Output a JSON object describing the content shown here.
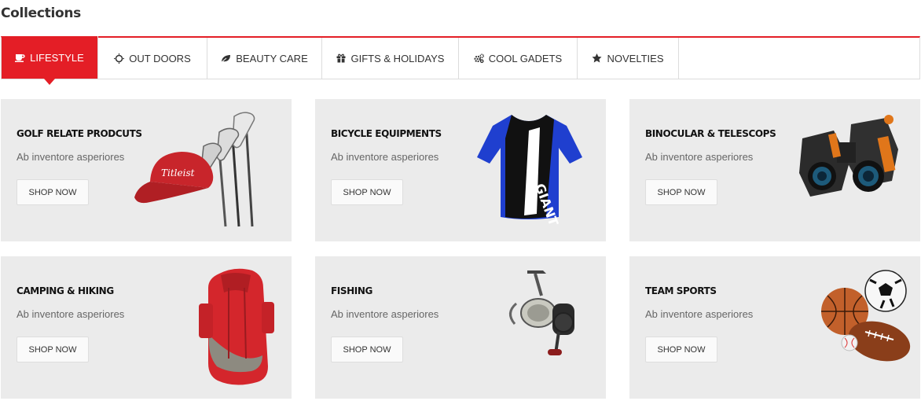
{
  "section": {
    "title": "Collections"
  },
  "tabs": [
    {
      "label": "LIFESTYLE",
      "icon": "cup-icon",
      "active": true
    },
    {
      "label": "OUT DOORS",
      "icon": "sun-icon",
      "active": false
    },
    {
      "label": "BEAUTY CARE",
      "icon": "leaf-icon",
      "active": false
    },
    {
      "label": "GIFTS & HOLIDAYS",
      "icon": "gift-icon",
      "active": false
    },
    {
      "label": "COOL GADETS",
      "icon": "gears-icon",
      "active": false
    },
    {
      "label": "NOVELTIES",
      "icon": "star-icon",
      "active": false
    }
  ],
  "products": [
    {
      "name": "GOLF RELATE PRODCUTS",
      "description": "Ab inventore asperiores",
      "button": "SHOP NOW",
      "image": "golf-clubs-and-cap"
    },
    {
      "name": "BICYCLE EQUIPMENTS",
      "description": "Ab inventore asperiores",
      "button": "SHOP NOW",
      "image": "cycling-jersey"
    },
    {
      "name": "BINOCULAR & TELESCOPS",
      "description": "Ab inventore asperiores",
      "button": "SHOP NOW",
      "image": "binoculars"
    },
    {
      "name": "CAMPING & HIKING",
      "description": "Ab inventore asperiores",
      "button": "SHOP NOW",
      "image": "red-backpack"
    },
    {
      "name": "FISHING",
      "description": "Ab inventore asperiores",
      "button": "SHOP NOW",
      "image": "fishing-reel"
    },
    {
      "name": "TEAM SPORTS",
      "description": "Ab inventore asperiores",
      "button": "SHOP NOW",
      "image": "sports-balls"
    }
  ],
  "colors": {
    "accent": "#e41e26",
    "card_bg": "#ebebeb",
    "border": "#dcdcdc"
  }
}
